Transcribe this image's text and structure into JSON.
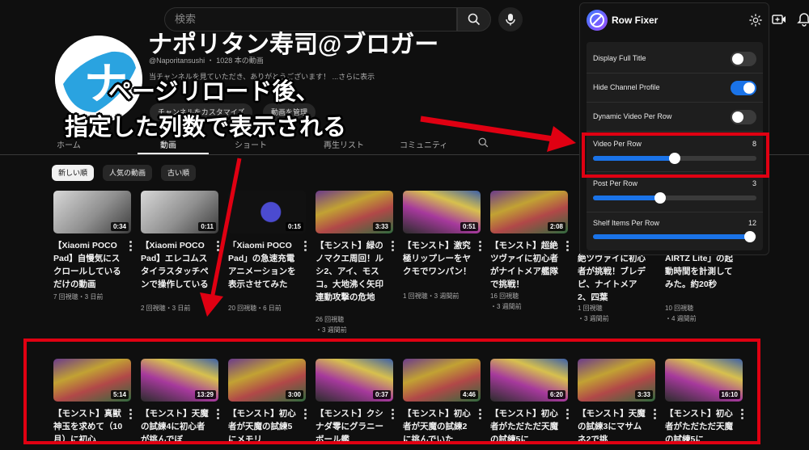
{
  "search": {
    "placeholder": "検索"
  },
  "channel": {
    "name": "ナポリタン寿司@ブロガー",
    "handle": "@Naporitansushi",
    "video_count": "1028 本の動画",
    "description": "当チャンネルを見ていただき、ありがとうございます！ ...さらに表示",
    "customize_label": "チャンネルをカスタマイズ",
    "manage_label": "動画を管理"
  },
  "tabs": [
    {
      "label": "ホーム"
    },
    {
      "label": "動画"
    },
    {
      "label": "ショート"
    },
    {
      "label": "再生リスト"
    },
    {
      "label": "コミュニティ"
    }
  ],
  "chips": [
    {
      "label": "新しい順"
    },
    {
      "label": "人気の動画"
    },
    {
      "label": "古い順"
    }
  ],
  "row1": [
    {
      "duration": "0:34",
      "title": "【Xiaomi POCO Pad】自慢気にスクロールしているだけの動画",
      "meta1": "7 回視聴・3 日前",
      "meta2": ""
    },
    {
      "duration": "0:11",
      "title": "【Xiaomi POCO Pad】エレコムスタイラスタッチペンで操作している動画",
      "meta1": "2 回視聴・3 日前",
      "meta2": ""
    },
    {
      "duration": "0:15",
      "title": "「Xiaomi POCO Pad」の急速充電アニメーションを表示させてみた",
      "meta1": "20 回視聴・6 日前",
      "meta2": ""
    },
    {
      "duration": "3:33",
      "title": "【モンスト】緑のノマクエ周回！ルシ2、アイ、モスコ。大地沸く矢印連動攻撃の危地",
      "meta1": "26 回視聴",
      "meta2": "・3 週間前"
    },
    {
      "duration": "0:51",
      "title": "【モンスト】激究極リップレーをヤクモでワンパン！",
      "meta1": "1 回視聴・3 週間前",
      "meta2": ""
    },
    {
      "duration": "2:08",
      "title": "【モンスト】超絶ツヴァイに初心者がナイトメア艦隊で挑戦！",
      "meta1": "16 回視聴",
      "meta2": "・3 週間前"
    },
    {
      "duration": "",
      "title": "絶ツヴァイに初心者が挑戦！ブレデピ、ナイトメア2、四葉",
      "meta1": "1 回視聴",
      "meta2": "・3 週間前"
    },
    {
      "duration": "",
      "title": "AIRTZ Lite」の起動時間を計測してみた。約20秒",
      "meta1": "10 回視聴",
      "meta2": "・4 週間前"
    }
  ],
  "row2": [
    {
      "duration": "5:14",
      "title": "【モンスト】真獣神玉を求めて（10月）に初心"
    },
    {
      "duration": "13:29",
      "title": "【モンスト】天魔の試練4に初心者が挑んでぼ"
    },
    {
      "duration": "3:00",
      "title": "【モンスト】初心者が天魔の試練5にメモリ"
    },
    {
      "duration": "0:37",
      "title": "【モンスト】クシナダ零にグラニーボール艦"
    },
    {
      "duration": "4:46",
      "title": "【モンスト】初心者が天魔の試練2に挑んでいた"
    },
    {
      "duration": "6:20",
      "title": "【モンスト】初心者がただただ天魔の試練5に"
    },
    {
      "duration": "3:33",
      "title": "【モンスト】天魔の試練3にマサムネ2で挑"
    },
    {
      "duration": "16:10",
      "title": "【モンスト】初心者がただただ天魔の試練5に"
    }
  ],
  "panel": {
    "title": "Row Fixer",
    "toggles": [
      {
        "label": "Display Full Title",
        "on": false
      },
      {
        "label": "Hide Channel Profile",
        "on": true
      },
      {
        "label": "Dynamic Video Per Row",
        "on": false
      }
    ],
    "sliders": [
      {
        "label": "Video Per Row",
        "value": "8",
        "level": 0.5
      },
      {
        "label": "Post Per Row",
        "value": "3",
        "level": 0.41
      },
      {
        "label": "Shelf Items Per Row",
        "value": "12",
        "level": 0.96
      }
    ]
  },
  "annotation": {
    "line1": "ページリロード後、",
    "line2": "指定した列数で表示される"
  },
  "colors": {
    "accent": "#1a73e8",
    "highlight": "#e00012",
    "background": "#0f0f0f"
  }
}
